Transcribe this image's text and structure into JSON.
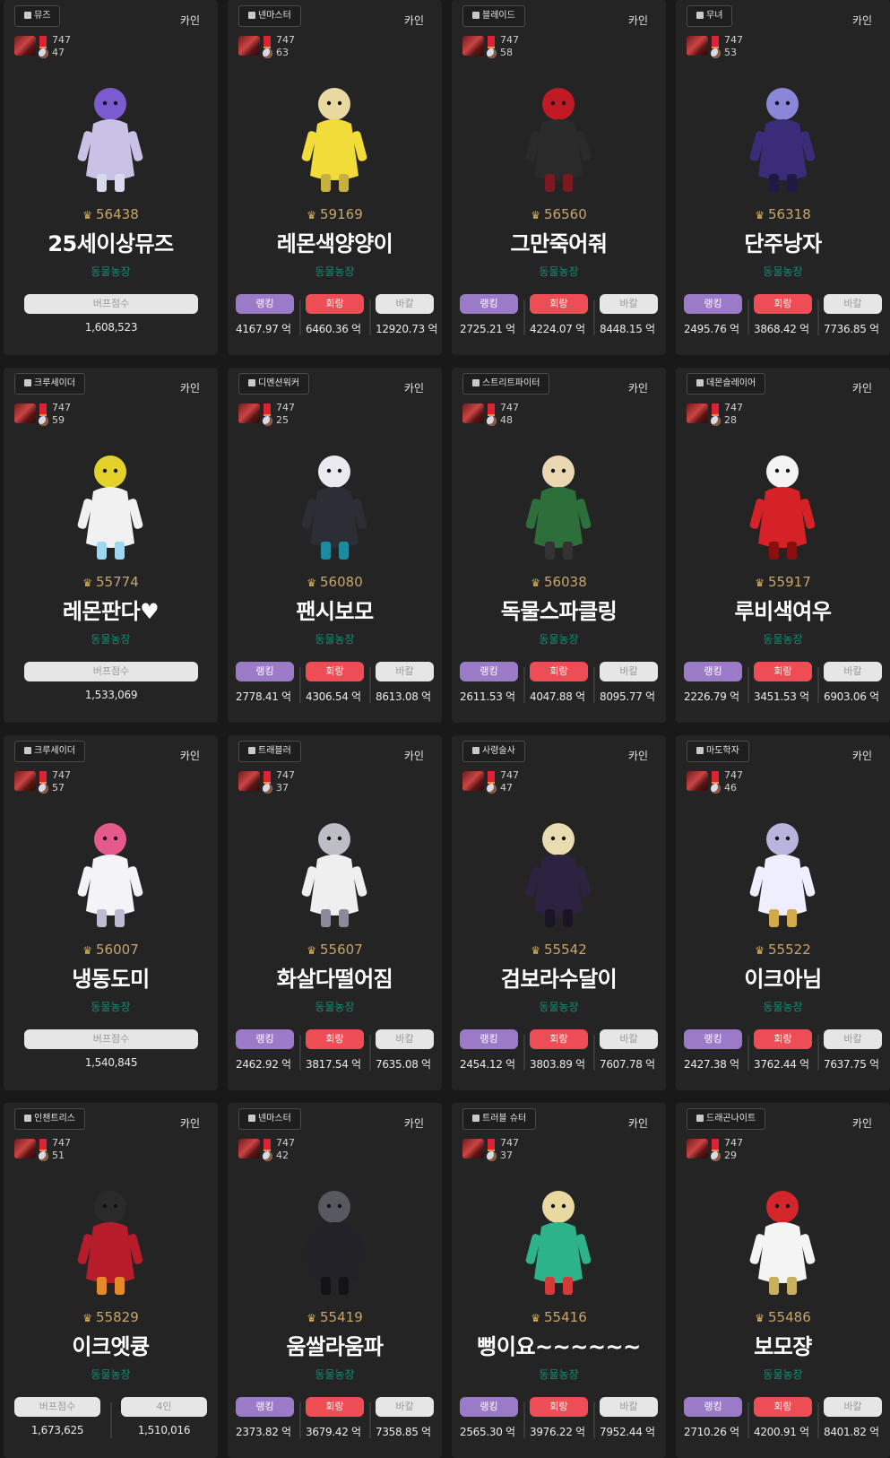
{
  "labels": {
    "buff": "버프점수",
    "party": "4인",
    "rank": "랭킹",
    "kill": "회랑",
    "bakal": "바칼",
    "unit": "억"
  },
  "cards": [
    {
      "job": "뮤즈",
      "server": "카인",
      "level": "747",
      "sub": "47",
      "fame": "56438",
      "name": "25세이상뮤즈",
      "guild": "동물농장",
      "kind": "buff",
      "buff": "1,608,523",
      "figure_colors": [
        "#c9c1e6",
        "#7c5bd0",
        "#d9d9ee"
      ]
    },
    {
      "job": "넨마스터",
      "server": "카인",
      "level": "747",
      "sub": "63",
      "fame": "59169",
      "name": "레몬색양양이",
      "guild": "동물농장",
      "kind": "dps",
      "rank": "4167.97",
      "kill": "6460.36",
      "bakal": "12920.73",
      "figure_colors": [
        "#f2dc3a",
        "#e9d9a0",
        "#c6b140"
      ]
    },
    {
      "job": "블레이드",
      "server": "카인",
      "level": "747",
      "sub": "58",
      "fame": "56560",
      "name": "그만죽어줘",
      "guild": "동물농장",
      "kind": "dps",
      "rank": "2725.21",
      "kill": "4224.07",
      "bakal": "8448.15",
      "figure_colors": [
        "#2a2a2a",
        "#c21a24",
        "#7a1a20"
      ]
    },
    {
      "job": "무녀",
      "server": "카인",
      "level": "747",
      "sub": "53",
      "fame": "56318",
      "name": "단주낭자",
      "guild": "동물농장",
      "kind": "dps",
      "rank": "2495.76",
      "kill": "3868.42",
      "bakal": "7736.85",
      "figure_colors": [
        "#3b2c7a",
        "#8a86d8",
        "#1f1a44"
      ]
    },
    {
      "job": "크루세이더",
      "server": "카인",
      "level": "747",
      "sub": "59",
      "fame": "55774",
      "name": "레몬판다♥",
      "guild": "동물농장",
      "kind": "buff",
      "buff": "1,533,069",
      "figure_colors": [
        "#f1f1f1",
        "#e3d22a",
        "#9fd7f0"
      ]
    },
    {
      "job": "디멘션워커",
      "server": "카인",
      "level": "747",
      "sub": "25",
      "fame": "56080",
      "name": "팬시보모",
      "guild": "동물농장",
      "kind": "dps",
      "rank": "2778.41",
      "kill": "4306.54",
      "bakal": "8613.08",
      "figure_colors": [
        "#2d2d35",
        "#e9e9ef",
        "#1d8aa0"
      ]
    },
    {
      "job": "스트리트파이터",
      "server": "카인",
      "level": "747",
      "sub": "48",
      "fame": "56038",
      "name": "독물스파클링",
      "guild": "동물농장",
      "kind": "dps",
      "rank": "2611.53",
      "kill": "4047.88",
      "bakal": "8095.77",
      "figure_colors": [
        "#2d6f3a",
        "#e8d7b0",
        "#333333"
      ]
    },
    {
      "job": "데몬슬레이어",
      "server": "카인",
      "level": "747",
      "sub": "28",
      "fame": "55917",
      "name": "루비색여우",
      "guild": "동물농장",
      "kind": "dps",
      "rank": "2226.79",
      "kill": "3451.53",
      "bakal": "6903.06",
      "figure_colors": [
        "#d62126",
        "#f4f4f4",
        "#8a1010"
      ]
    },
    {
      "job": "크루세이더",
      "server": "카인",
      "level": "747",
      "sub": "57",
      "fame": "56007",
      "name": "냉동도미",
      "guild": "동물농장",
      "kind": "buff",
      "buff": "1,540,845",
      "figure_colors": [
        "#f4f4f8",
        "#e55a8a",
        "#bcbcd0"
      ]
    },
    {
      "job": "트래블러",
      "server": "카인",
      "level": "747",
      "sub": "37",
      "fame": "55607",
      "name": "화살다떨어짐",
      "guild": "동물농장",
      "kind": "dps",
      "rank": "2462.92",
      "kill": "3817.54",
      "bakal": "7635.08",
      "figure_colors": [
        "#efefef",
        "#bdbdc6",
        "#8a8a99"
      ]
    },
    {
      "job": "사령술사",
      "server": "카인",
      "level": "747",
      "sub": "47",
      "fame": "55542",
      "name": "검보라수달이",
      "guild": "동물농장",
      "kind": "dps",
      "rank": "2454.12",
      "kill": "3803.89",
      "bakal": "7607.78",
      "figure_colors": [
        "#2d2240",
        "#e9dcb0",
        "#1a1426"
      ]
    },
    {
      "job": "마도학자",
      "server": "카인",
      "level": "747",
      "sub": "46",
      "fame": "55522",
      "name": "이크아님",
      "guild": "동물농장",
      "kind": "dps",
      "rank": "2427.38",
      "kill": "3762.44",
      "bakal": "7637.75",
      "figure_colors": [
        "#eeeeff",
        "#b9b4de",
        "#d4a94a"
      ]
    },
    {
      "job": "인챈트리스",
      "server": "카인",
      "level": "747",
      "sub": "51",
      "fame": "55829",
      "name": "이크엣큥",
      "guild": "동물농장",
      "kind": "buffparty",
      "buff": "1,673,625",
      "party": "1,510,016",
      "figure_colors": [
        "#b71c2a",
        "#2a2a2a",
        "#e58a2a"
      ]
    },
    {
      "job": "넨마스터",
      "server": "카인",
      "level": "747",
      "sub": "42",
      "fame": "55419",
      "name": "움쌀라움파",
      "guild": "동물농장",
      "kind": "dps",
      "rank": "2373.82",
      "kill": "3679.42",
      "bakal": "7358.85",
      "figure_colors": [
        "#222228",
        "#585860",
        "#141418"
      ]
    },
    {
      "job": "트러블 슈터",
      "server": "카인",
      "level": "747",
      "sub": "37",
      "fame": "55416",
      "name": "뻥이요~~~~~~",
      "guild": "동물농장",
      "kind": "dps",
      "rank": "2565.30",
      "kill": "3976.22",
      "bakal": "7952.44",
      "figure_colors": [
        "#2db38a",
        "#e9d9a0",
        "#d33a3a"
      ]
    },
    {
      "job": "드래곤나이트",
      "server": "카인",
      "level": "747",
      "sub": "29",
      "fame": "55486",
      "name": "보모쟝",
      "guild": "동물농장",
      "kind": "dps",
      "rank": "2710.26",
      "kill": "4200.91",
      "bakal": "8401.82",
      "figure_colors": [
        "#f4f4f4",
        "#d2262a",
        "#c8b060"
      ]
    }
  ]
}
